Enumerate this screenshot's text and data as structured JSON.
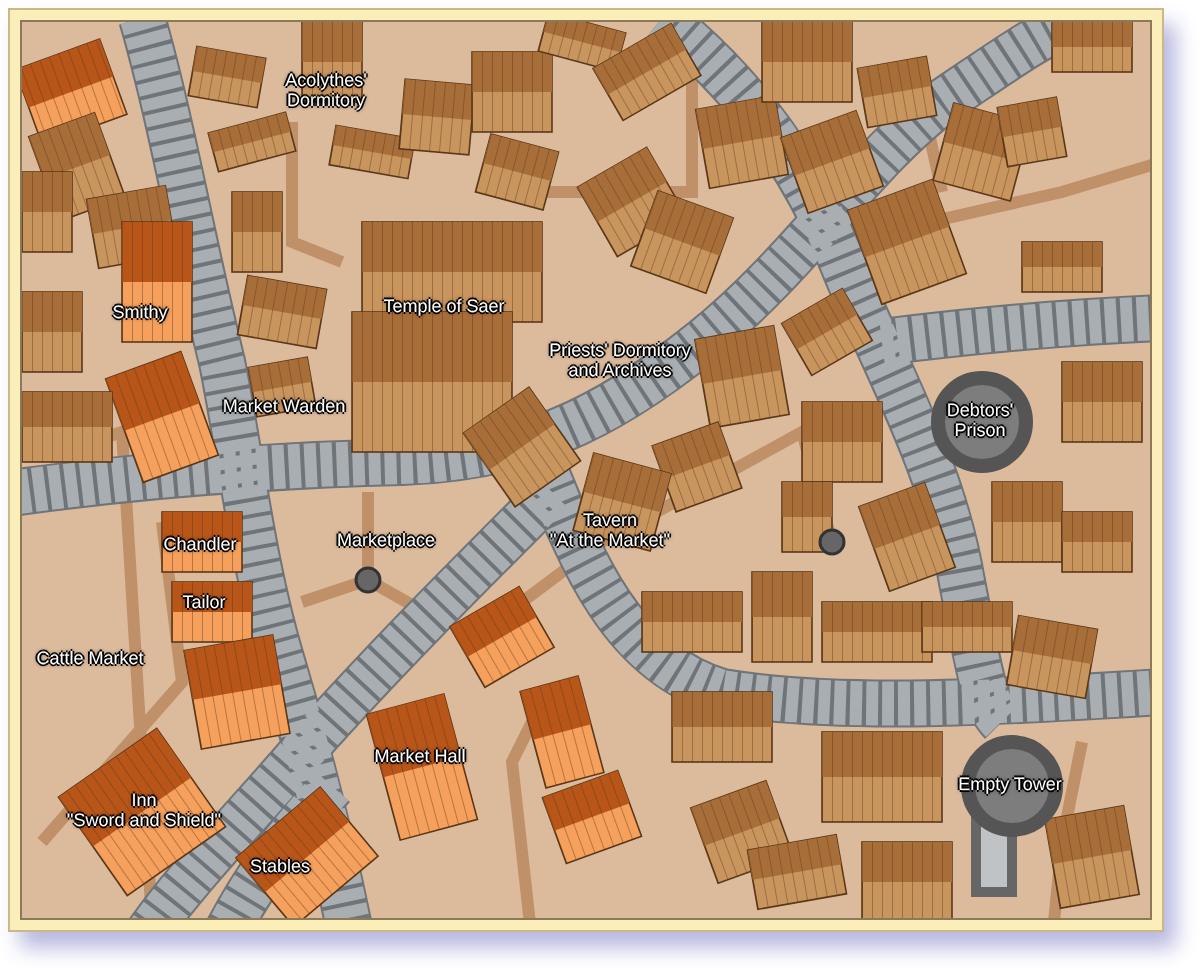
{
  "map": {
    "labels": [
      {
        "lines": [
          "Acolythes'",
          "Dormitory"
        ]
      },
      {
        "lines": [
          "Smithy"
        ]
      },
      {
        "lines": [
          "Temple of Saer"
        ]
      },
      {
        "lines": [
          "Priests' Dormitory",
          "and Archives"
        ]
      },
      {
        "lines": [
          "Market Warden"
        ]
      },
      {
        "lines": [
          "Debtors'",
          "Prison"
        ]
      },
      {
        "lines": [
          "Chandler"
        ]
      },
      {
        "lines": [
          "Marketplace"
        ]
      },
      {
        "lines": [
          "Tavern",
          "\"At the Market\""
        ]
      },
      {
        "lines": [
          "Tailor"
        ]
      },
      {
        "lines": [
          "Cattle Market"
        ]
      },
      {
        "lines": [
          "Market Hall"
        ]
      },
      {
        "lines": [
          "Inn",
          "\"Sword and Shield\""
        ]
      },
      {
        "lines": [
          "Empty Tower"
        ]
      },
      {
        "lines": [
          "Stables"
        ]
      }
    ]
  }
}
